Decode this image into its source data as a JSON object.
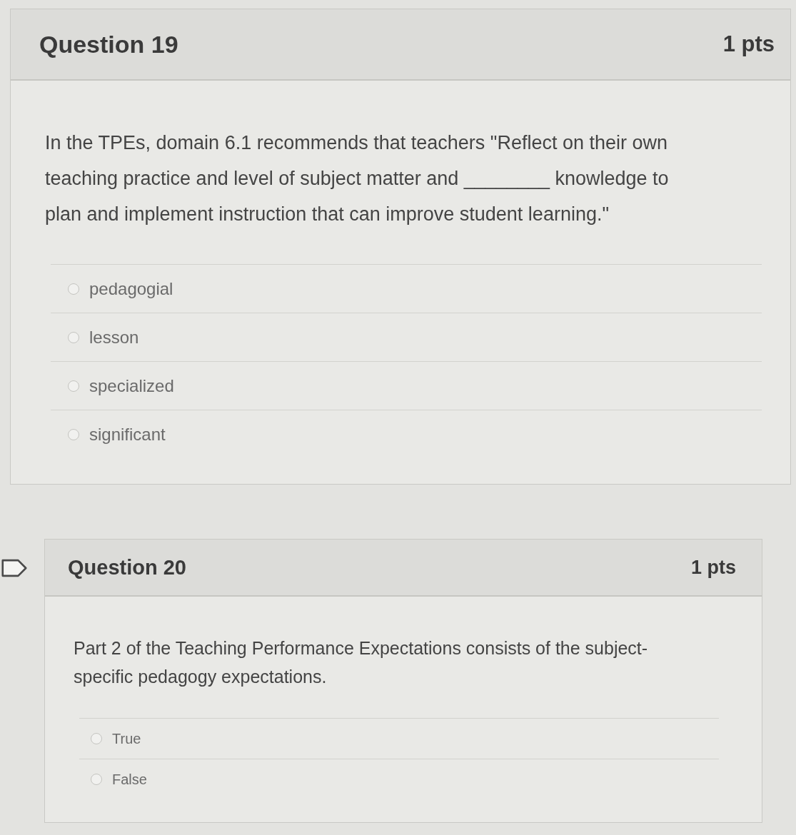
{
  "questions": [
    {
      "title": "Question 19",
      "points": "1 pts",
      "text": "In the TPEs, domain 6.1 recommends that teachers \"Reflect on their own teaching practice and level of subject matter and ________ knowledge to plan and implement instruction that can improve student learning.\"",
      "answers": [
        {
          "label": "pedagogial",
          "selected": false
        },
        {
          "label": "lesson",
          "selected": false
        },
        {
          "label": "specialized",
          "selected": false
        },
        {
          "label": "significant",
          "selected": false
        }
      ]
    },
    {
      "title": "Question 20",
      "points": "1 pts",
      "flag": {
        "flagged": false
      },
      "text": "Part 2 of the Teaching Performance Expectations consists of the subject-specific pedagogy expectations.",
      "answers": [
        {
          "label": "True",
          "selected": false
        },
        {
          "label": "False",
          "selected": false
        }
      ]
    }
  ]
}
